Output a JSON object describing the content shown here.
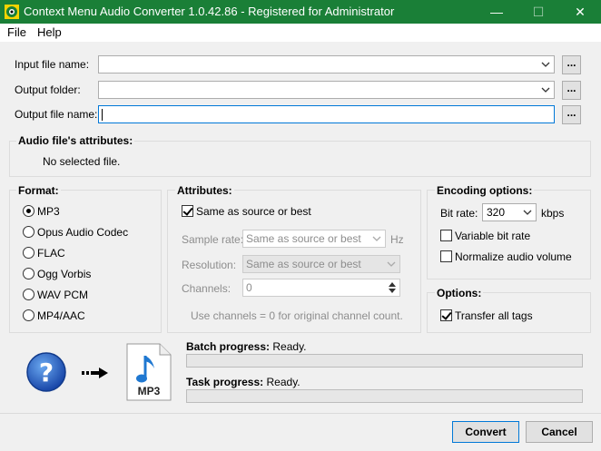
{
  "window": {
    "title": "Context Menu Audio Converter 1.0.42.86 - Registered for Administrator",
    "minimize": "—",
    "maximize": "☐",
    "close": "✕"
  },
  "menu": {
    "file": "File",
    "help": "Help"
  },
  "input_file": {
    "label": "Input file name:",
    "value": "",
    "browse": "..."
  },
  "output_folder": {
    "label": "Output folder:",
    "value": "",
    "browse": "..."
  },
  "output_file": {
    "label": "Output file name:",
    "value": "",
    "browse": "..."
  },
  "attributes_info": {
    "title": "Audio file's attributes:",
    "text": "No selected file."
  },
  "format": {
    "title": "Format:",
    "options": [
      "MP3",
      "Opus Audio Codec",
      "FLAC",
      "Ogg Vorbis",
      "WAV PCM",
      "MP4/AAC"
    ],
    "selected": "MP3"
  },
  "attributes": {
    "title": "Attributes:",
    "same_as_source": "Same as source or best",
    "sample_rate_label": "Sample rate:",
    "sample_rate_value": "Same as source or best",
    "sample_rate_unit": "Hz",
    "resolution_label": "Resolution:",
    "resolution_value": "Same as source or best",
    "channels_label": "Channels:",
    "channels_value": "0",
    "hint": "Use channels = 0 for original channel count."
  },
  "encoding": {
    "title": "Encoding options:",
    "bitrate_label": "Bit rate:",
    "bitrate_value": "320",
    "bitrate_unit": "kbps",
    "vbr": "Variable bit rate",
    "normalize": "Normalize audio volume"
  },
  "options": {
    "title": "Options:",
    "transfer_tags": "Transfer all tags"
  },
  "progress": {
    "batch_label": "Batch progress:",
    "batch_status": "Ready.",
    "batch_value": 0,
    "task_label": "Task progress:",
    "task_status": "Ready.",
    "task_value": 0
  },
  "file_icon_label": "MP3",
  "buttons": {
    "convert": "Convert",
    "cancel": "Cancel"
  }
}
